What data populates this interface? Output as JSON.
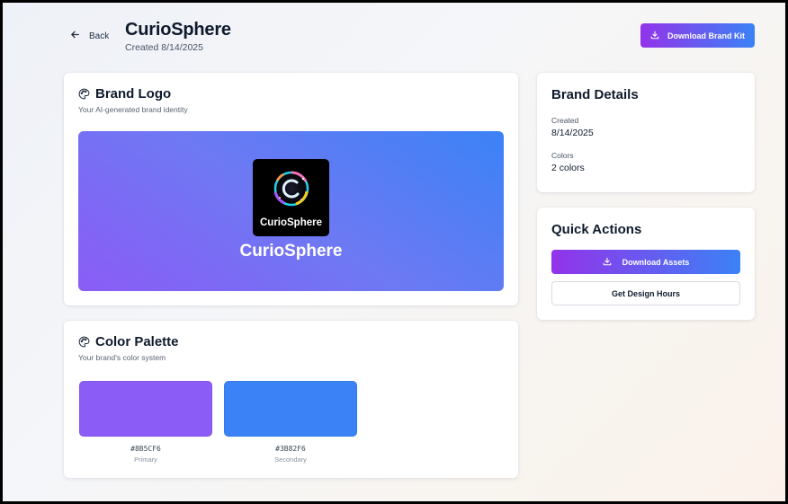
{
  "header": {
    "back_label": "Back",
    "title": "CurioSphere",
    "created": "Created 8/14/2025",
    "download_kit_label": "Download Brand Kit"
  },
  "logo_card": {
    "title": "Brand Logo",
    "subtitle": "Your AI-generated brand identity",
    "logo_text": "CurioSphere",
    "brand_name": "CurioSphere"
  },
  "palette_card": {
    "title": "Color Palette",
    "subtitle": "Your brand's color system",
    "colors": [
      {
        "hex": "#8B5CF6",
        "role": "Primary",
        "value": "#8b5cf6"
      },
      {
        "hex": "#3B82F6",
        "role": "Secondary",
        "value": "#3b82f6"
      }
    ]
  },
  "details_card": {
    "title": "Brand Details",
    "created_label": "Created",
    "created_value": "8/14/2025",
    "colors_label": "Colors",
    "colors_value": "2 colors"
  },
  "actions_card": {
    "title": "Quick Actions",
    "download_assets_label": "Download Assets",
    "design_hours_label": "Get Design Hours"
  },
  "theme": {
    "gradient_start": "#9333ea",
    "gradient_end": "#3b82f6"
  },
  "icons": {
    "back": "arrow-left-icon",
    "download": "download-icon",
    "palette": "palette-icon"
  }
}
